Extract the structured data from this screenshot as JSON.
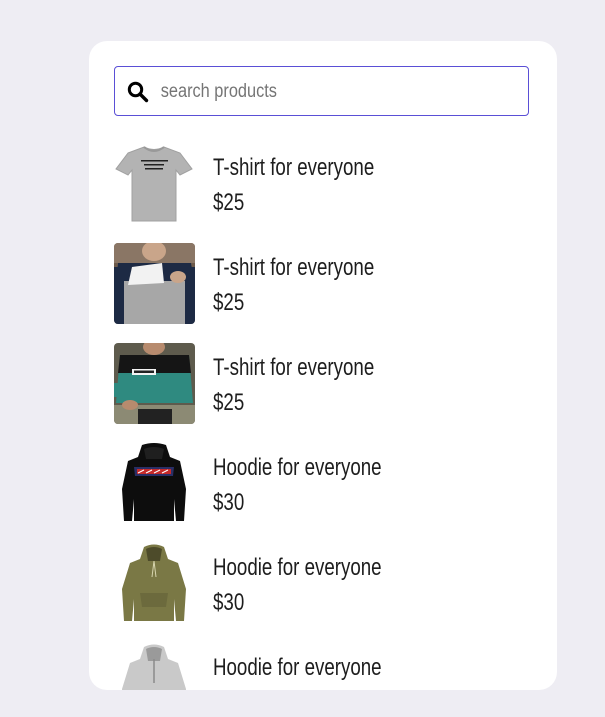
{
  "search": {
    "placeholder": "search products",
    "value": ""
  },
  "products": [
    {
      "name": "T-shirt for everyone",
      "price": "$25",
      "image": "grey-tshirt-image"
    },
    {
      "name": "T-shirt for everyone",
      "price": "$25",
      "image": "colorblock-shirt-image"
    },
    {
      "name": "T-shirt for everyone",
      "price": "$25",
      "image": "teal-sweatshirt-image"
    },
    {
      "name": "Hoodie for everyone",
      "price": "$30",
      "image": "black-hoodie-image"
    },
    {
      "name": "Hoodie for everyone",
      "price": "$30",
      "image": "olive-hoodie-image"
    },
    {
      "name": "Hoodie for everyone",
      "price": "",
      "image": "grey-hoodie-image"
    }
  ],
  "colors": {
    "page_background": "#eeedf3",
    "card_background": "#ffffff",
    "search_border": "#5a4fd6",
    "text": "#1d1d1d"
  }
}
